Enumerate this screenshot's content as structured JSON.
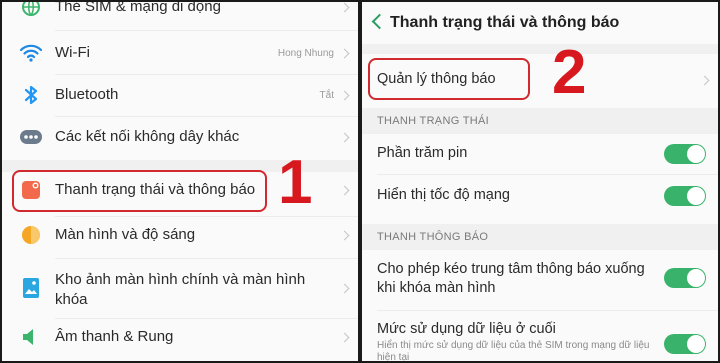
{
  "left": {
    "items": [
      {
        "label": "Thẻ SIM & mạng di động",
        "value": "",
        "icon": "sim-globe-icon",
        "color": "#3cb56c"
      },
      {
        "label": "Wi-Fi",
        "value": "Hong Nhung",
        "icon": "wifi-icon",
        "color": "#1e88e5"
      },
      {
        "label": "Bluetooth",
        "value": "Tắt",
        "icon": "bluetooth-icon",
        "color": "#2196f3"
      },
      {
        "label": "Các kết nối không dây khác",
        "value": "",
        "icon": "more-connections-icon",
        "color": "#6b7b8c"
      },
      {
        "label": "Thanh trạng thái và thông báo",
        "value": "",
        "icon": "notification-bar-icon",
        "color": "#f26a4b"
      },
      {
        "label": "Màn hình và độ sáng",
        "value": "",
        "icon": "brightness-icon",
        "color": "#f5a623"
      },
      {
        "label": "Kho ảnh màn hình chính và màn hình khóa",
        "value": "",
        "icon": "wallpaper-icon",
        "color": "#2aa6e0"
      },
      {
        "label": "Âm thanh & Rung",
        "value": "",
        "icon": "sound-icon",
        "color": "#3cb56c"
      }
    ],
    "step_number": "1"
  },
  "right": {
    "title": "Thanh trạng thái và thông báo",
    "manage_label": "Quản lý thông báo",
    "step_number": "2",
    "section_status": "THANH TRẠNG THÁI",
    "battery_percent": "Phần trăm pin",
    "network_speed": "Hiển thị tốc độ mạng",
    "section_notify": "THANH THÔNG BÁO",
    "pull_down": "Cho phép kéo trung tâm thông báo xuống khi khóa màn hình",
    "data_usage": "Mức sử dụng dữ liệu ở cuối",
    "data_usage_sub": "Hiển thị mức sử dụng dữ liệu của thẻ SIM trong mạng dữ liệu hiện tại",
    "toggles": {
      "battery": true,
      "speed": true,
      "pull": true,
      "data": true
    }
  },
  "colors": {
    "accent_green": "#39b36b",
    "highlight_red": "#d02a2f"
  }
}
